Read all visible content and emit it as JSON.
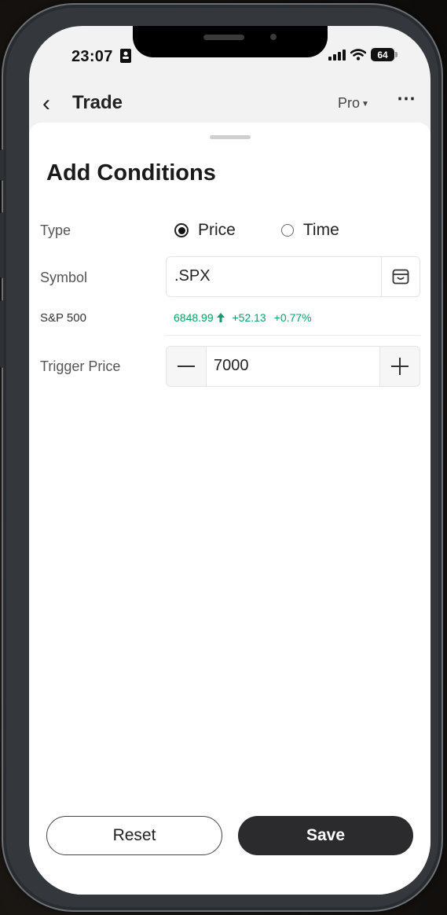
{
  "status_bar": {
    "time": "23:07",
    "battery": "64",
    "icons": [
      "id-card-icon",
      "signal-icon",
      "wifi-icon",
      "battery-icon"
    ]
  },
  "nav": {
    "title": "Trade",
    "mode": "Pro",
    "icons": [
      "back-chevron-icon",
      "caret-down-icon",
      "more-dots-icon"
    ]
  },
  "sheet": {
    "title": "Add Conditions",
    "type": {
      "label": "Type",
      "options": [
        "Price",
        "Time"
      ],
      "selected": "Price"
    },
    "symbol": {
      "label": "Symbol",
      "value": ".SPX",
      "icon": "symbol-picker-icon"
    },
    "quote": {
      "name": "S&P 500",
      "price": "6848.99",
      "change": "+52.13",
      "change_pct": "+0.77%",
      "color": "#0e9d6a",
      "direction_icon": "up-arrow-icon"
    },
    "trigger": {
      "label": "Trigger Price",
      "value": "7000",
      "minus_icon": "minus-icon",
      "plus_icon": "plus-icon"
    }
  },
  "actions": {
    "reset_label": "Reset",
    "save_label": "Save"
  }
}
